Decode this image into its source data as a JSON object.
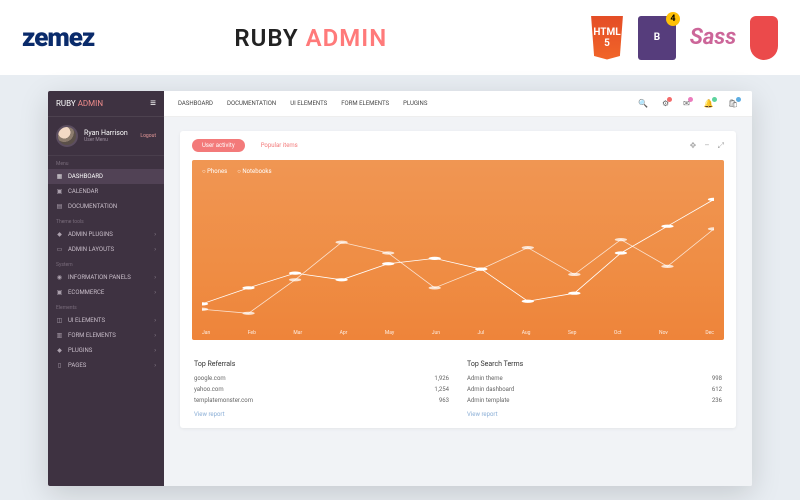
{
  "hero": {
    "logo_text": "zemez",
    "title_a": "RUBY",
    "title_b": "ADMIN",
    "tech": {
      "html5": "HTML",
      "html5_sub": "5",
      "bs": "B",
      "sass": "Sass",
      "gulp": "gulp"
    }
  },
  "sidebar": {
    "brand_a": "RUBY",
    "brand_b": "ADMIN",
    "user": {
      "name": "Ryan Harrison",
      "meta": "User Menu",
      "logout": "Logout"
    },
    "sections": {
      "menu": "Menu",
      "theme": "Theme tools",
      "system": "System",
      "elements": "Elements"
    },
    "items": [
      {
        "label": "DASHBOARD",
        "active": true,
        "chev": false
      },
      {
        "label": "CALENDAR",
        "active": false,
        "chev": false
      },
      {
        "label": "DOCUMENTATION",
        "active": false,
        "chev": false
      },
      {
        "label": "ADMIN PLUGINS",
        "active": false,
        "chev": true
      },
      {
        "label": "ADMIN LAYOUTS",
        "active": false,
        "chev": true
      },
      {
        "label": "INFORMATION PANELS",
        "active": false,
        "chev": true
      },
      {
        "label": "ECOMMERCE",
        "active": false,
        "chev": true
      },
      {
        "label": "UI ELEMENTS",
        "active": false,
        "chev": true
      },
      {
        "label": "FORM ELEMENTS",
        "active": false,
        "chev": true
      },
      {
        "label": "PLUGINS",
        "active": false,
        "chev": true
      },
      {
        "label": "PAGES",
        "active": false,
        "chev": true
      }
    ]
  },
  "topnav": [
    "DASHBOARD",
    "DOCUMENTATION",
    "UI ELEMENTS",
    "FORM ELEMENTS",
    "PLUGINS"
  ],
  "tabs": {
    "active": "User activity",
    "inactive": "Popular items"
  },
  "chart_data": {
    "type": "line",
    "x": [
      "Jan",
      "Feb",
      "Mar",
      "Apr",
      "May",
      "Jun",
      "Jul",
      "Aug",
      "Sep",
      "Oct",
      "Nov",
      "Dec"
    ],
    "series": [
      {
        "name": "Phones",
        "values": [
          12,
          24,
          35,
          30,
          42,
          46,
          38,
          14,
          20,
          50,
          70,
          90
        ]
      },
      {
        "name": "Notebooks",
        "values": [
          8,
          5,
          30,
          58,
          50,
          24,
          38,
          54,
          34,
          60,
          40,
          68
        ]
      }
    ],
    "ylim": [
      0,
      100
    ],
    "color": "#ffffff"
  },
  "referrals": {
    "title": "Top Referrals",
    "rows": [
      {
        "site": "google.com",
        "count": "1,926"
      },
      {
        "site": "yahoo.com",
        "count": "1,254"
      },
      {
        "site": "templatemonster.com",
        "count": "963"
      }
    ],
    "view": "View report"
  },
  "search_terms": {
    "title": "Top Search Terms",
    "rows": [
      {
        "term": "Admin theme",
        "count": "998"
      },
      {
        "term": "Admin dashboard",
        "count": "612"
      },
      {
        "term": "Admin template",
        "count": "236"
      }
    ],
    "view": "View report"
  }
}
